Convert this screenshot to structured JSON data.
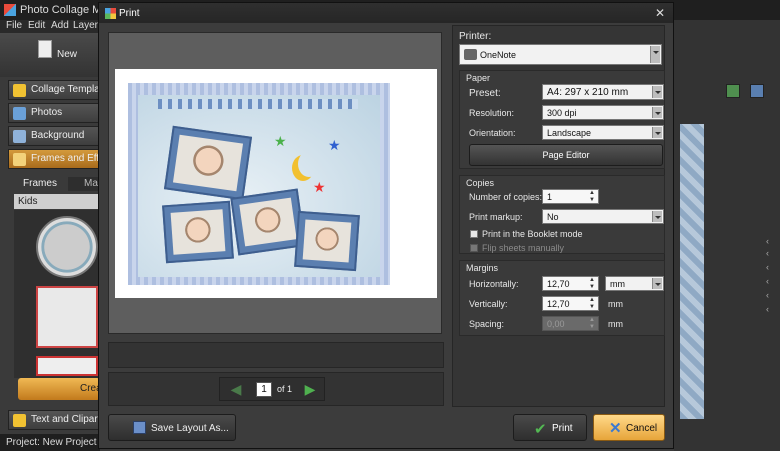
{
  "app": {
    "title": "Photo Collage Maker - N",
    "menu": [
      "File",
      "Edit",
      "Add",
      "Layer"
    ],
    "toolbar": {
      "new_label": "New"
    },
    "sidebar": [
      {
        "label": "Collage Templates",
        "icon": "star-icon",
        "active": false
      },
      {
        "label": "Photos",
        "icon": "photos-icon",
        "active": false
      },
      {
        "label": "Background",
        "icon": "background-icon",
        "active": false
      },
      {
        "label": "Frames and Effects",
        "icon": "frames-icon",
        "active": true
      }
    ],
    "tabs": {
      "frames": "Frames",
      "masks": "Mas"
    },
    "category": "Kids",
    "create_label": "Crea",
    "text_clipart_label": "Text and Clipart",
    "status": "Project: New Project"
  },
  "dialog": {
    "title": "Print",
    "printer_label": "Printer:",
    "printer_value": "OneNote",
    "paper": {
      "title": "Paper",
      "preset_label": "Preset:",
      "preset_value": "A4: 297 x 210 mm",
      "resolution_label": "Resolution:",
      "resolution_value": "300 dpi",
      "orientation_label": "Orientation:",
      "orientation_value": "Landscape",
      "page_editor_label": "Page Editor"
    },
    "copies": {
      "title": "Copies",
      "number_label": "Number of copies:",
      "number_value": "1",
      "markup_label": "Print markup:",
      "markup_value": "No",
      "booklet_label": "Print in the Booklet mode",
      "flip_label": "Flip sheets manually"
    },
    "margins": {
      "title": "Margins",
      "horizontal_label": "Horizontally:",
      "horizontal_value": "12,70",
      "unit_value": "mm",
      "vertical_label": "Vertically:",
      "vertical_value": "12,70",
      "vertical_unit": "mm",
      "spacing_label": "Spacing:",
      "spacing_value": "0,00",
      "spacing_unit": "mm"
    },
    "pager": {
      "current": "1",
      "of_label": "of 1"
    },
    "save_layout_label": "Save Layout As...",
    "print_label": "Print",
    "cancel_label": "Cancel"
  }
}
